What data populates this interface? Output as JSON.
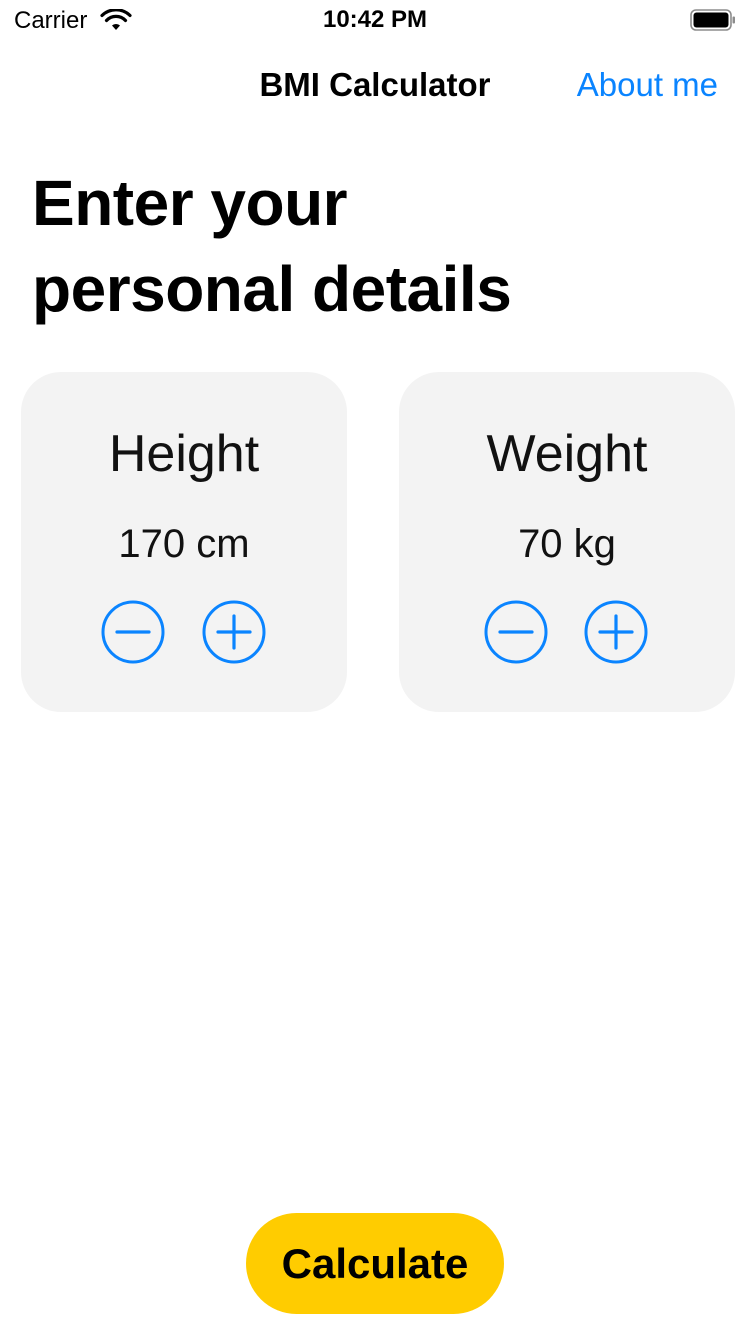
{
  "status_bar": {
    "carrier": "Carrier",
    "time": "10:42 PM",
    "icons": [
      "wifi-icon",
      "battery-icon"
    ]
  },
  "nav": {
    "title": "BMI Calculator",
    "right_button": "About me"
  },
  "heading": {
    "line1": "Enter your",
    "line2": "personal details"
  },
  "cards": {
    "height": {
      "title": "Height",
      "value": "170 cm",
      "icons": [
        "minus-circle-icon",
        "plus-circle-icon"
      ]
    },
    "weight": {
      "title": "Weight",
      "value": "70 kg",
      "icons": [
        "minus-circle-icon",
        "plus-circle-icon"
      ]
    }
  },
  "calculate_button": "Calculate",
  "colors": {
    "accent": "#0a84ff",
    "button": "#ffcc00",
    "card_background": "#f3f3f3"
  }
}
